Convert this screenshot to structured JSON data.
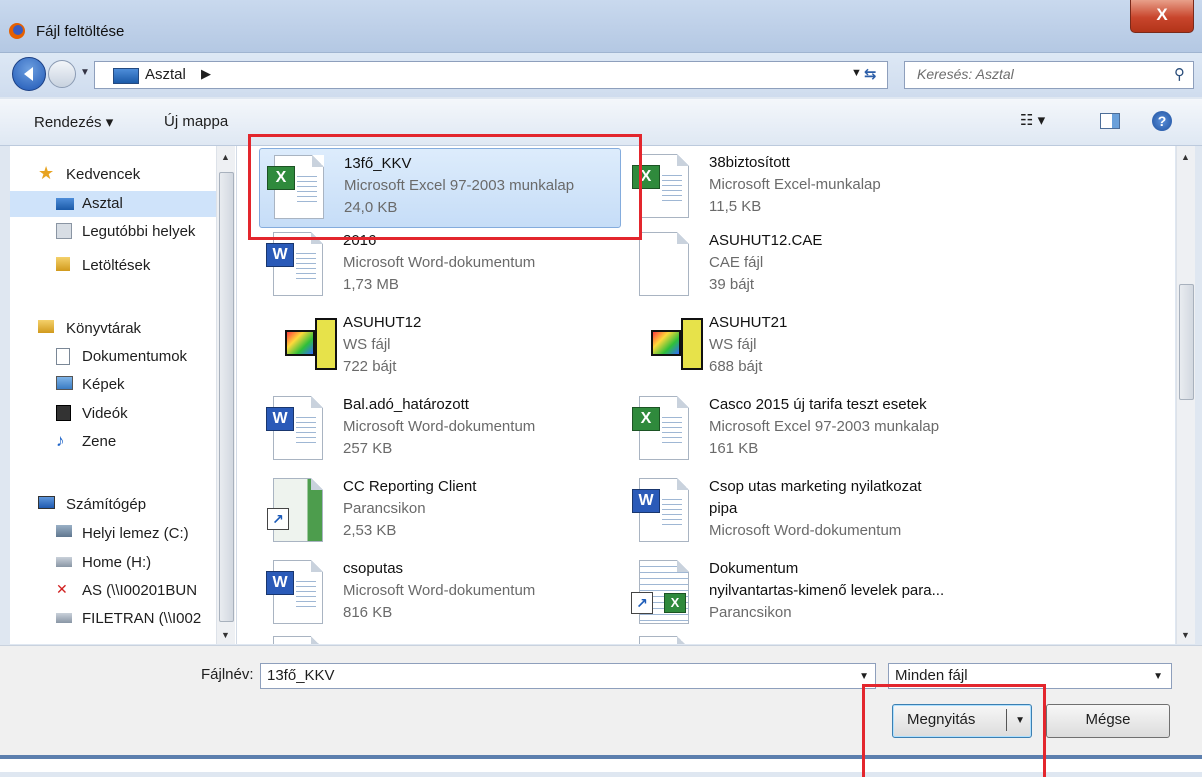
{
  "window": {
    "title": "Fájl feltöltése",
    "close_label": "X"
  },
  "nav": {
    "address_crumb": "Asztal",
    "search_placeholder": "Keresés: Asztal"
  },
  "toolbar": {
    "organize_label": "Rendezés ▾",
    "new_folder_label": "Új mappa"
  },
  "sidebar": {
    "items": [
      {
        "label": "Kedvencek",
        "icon": "star-icon"
      },
      {
        "label": "Asztal",
        "icon": "desktop-icon",
        "selected": true
      },
      {
        "label": "Legutóbbi helyek",
        "icon": "recent-places-icon"
      },
      {
        "label": "Letöltések",
        "icon": "downloads-icon"
      },
      {
        "label": "Könyvtárak",
        "icon": "libraries-icon"
      },
      {
        "label": "Dokumentumok",
        "icon": "documents-icon"
      },
      {
        "label": "Képek",
        "icon": "pictures-icon"
      },
      {
        "label": "Videók",
        "icon": "videos-icon"
      },
      {
        "label": "Zene",
        "icon": "music-icon"
      },
      {
        "label": "Számítógép",
        "icon": "computer-icon"
      },
      {
        "label": "Helyi lemez (C:)",
        "icon": "local-disk-icon"
      },
      {
        "label": "Home (H:)",
        "icon": "network-drive-icon"
      },
      {
        "label": "AS (\\\\I00201BUN",
        "icon": "disconnected-drive-icon"
      },
      {
        "label": "FILETRAN (\\\\I002",
        "icon": "network-drive-icon"
      }
    ]
  },
  "files": [
    {
      "name": "13fő_KKV",
      "type": "Microsoft Excel 97-2003 munkalap",
      "size": "24,0 KB",
      "icon": "excel-icon",
      "selected": true
    },
    {
      "name": "38biztosított",
      "type": "Microsoft Excel-munkalap",
      "size": "11,5 KB",
      "icon": "excel-icon"
    },
    {
      "name": "2016",
      "type": "Microsoft Word-dokumentum",
      "size": "1,73 MB",
      "icon": "word-icon"
    },
    {
      "name": "ASUHUT12.CAE",
      "type": "CAE fájl",
      "size": "39 bájt",
      "icon": "blank-file-icon"
    },
    {
      "name": "ASUHUT12",
      "type": "WS fájl",
      "size": "722 bájt",
      "icon": "ws-file-icon"
    },
    {
      "name": "ASUHUT21",
      "type": "WS fájl",
      "size": "688 bájt",
      "icon": "ws-file-icon"
    },
    {
      "name": "Bal.adó_határozott",
      "type": "Microsoft Word-dokumentum",
      "size": "257 KB",
      "icon": "word-icon"
    },
    {
      "name": "Casco 2015 új tarifa teszt esetek",
      "type": "Microsoft Excel 97-2003 munkalap",
      "size": "161 KB",
      "icon": "excel-icon"
    },
    {
      "name": "CC Reporting Client",
      "type": "Parancsikon",
      "size": "2,53 KB",
      "icon": "shortcut-icon"
    },
    {
      "name": "Csop utas marketing nyilatkozat",
      "type": "pipa",
      "size": "Microsoft Word-dokumentum",
      "icon": "word-icon"
    },
    {
      "name": "csoputas",
      "type": "Microsoft Word-dokumentum",
      "size": "816 KB",
      "icon": "word-icon"
    },
    {
      "name": "Dokumentum",
      "type": "nyilvantartas-kimenő levelek para...",
      "size": "Parancsikon",
      "icon": "shortcut-excel-icon"
    }
  ],
  "bottom": {
    "filename_label": "Fájlnév:",
    "filename_value": "13fő_KKV",
    "filter_value": "Minden fájl",
    "open_label": "Megnyitás",
    "cancel_label": "Mégse"
  }
}
